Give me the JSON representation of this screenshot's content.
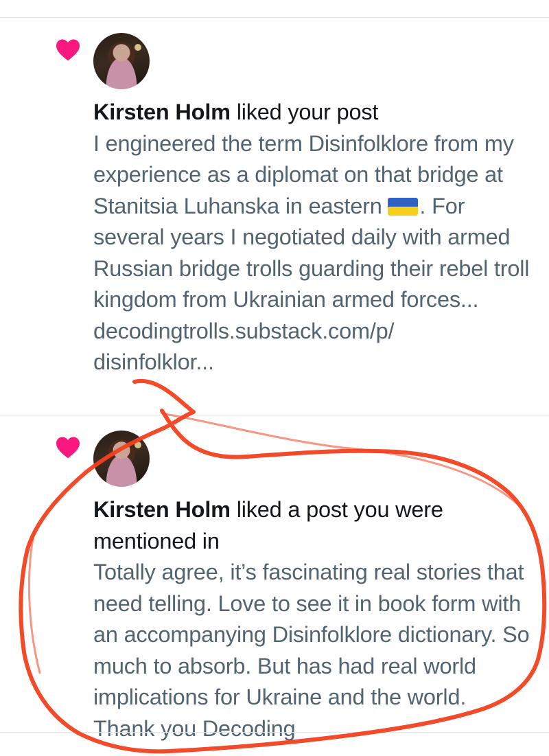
{
  "notifications": [
    {
      "type": "like",
      "actor_name": "Kirsten Holm",
      "action": " liked your post",
      "body_before_flag": "I engineered the term Disinfolklore from my experience as a diplomat on that bridge at Stanitsia Luhanska in eastern ",
      "flag_icon": "ukraine-flag-emoji",
      "body_after_flag": ". For several years I negotiated daily with armed Russian bridge trolls guarding their rebel troll kingdom from Ukrainian armed forces...",
      "link_line1": "decodingtrolls.substack.com/p/",
      "link_line2": "disinfolklor..."
    },
    {
      "type": "like",
      "actor_name": "Kirsten Holm",
      "action": " liked a post you were mentioned in",
      "body": "Totally agree, it’s fascinating real stories that need telling. Love to see it in book form with an accompanying Disinfolklore dictionary. So much to absorb. But has had real world implications for Ukraine and the world. Thank you Decoding"
    }
  ],
  "colors": {
    "heart": "#f91880",
    "headline": "#14171a",
    "body": "#536471",
    "annotation": "#f2401f"
  },
  "icons": {
    "like": "heart-icon",
    "avatar": "user-avatar"
  }
}
